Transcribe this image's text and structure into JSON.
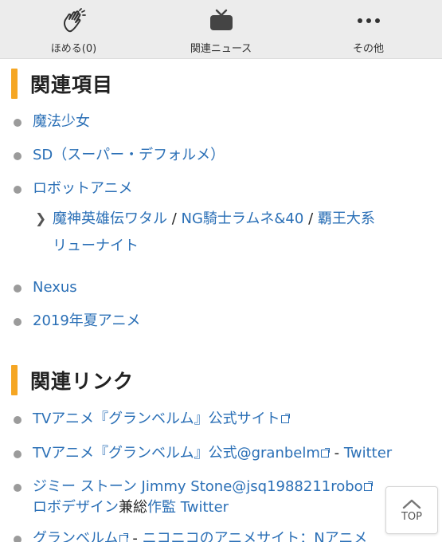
{
  "toolbar": {
    "items": [
      {
        "label": "ほめる(0)",
        "icon": "clap-hands-icon"
      },
      {
        "label": "関連ニュース",
        "icon": "tv-icon"
      },
      {
        "label": "その他",
        "icon": "more-dots-icon"
      }
    ]
  },
  "related_items": {
    "title": "関連項目",
    "items": [
      {
        "text": "魔法少女"
      },
      {
        "text_link": "SD",
        "text_rest": "（スーパー・デフォルメ）"
      },
      {
        "text": "ロボットアニメ"
      },
      {
        "text": "Nexus"
      },
      {
        "text": "2019年夏アニメ"
      }
    ],
    "sub": {
      "link1": "魔神英雄伝ワタル",
      "sep1": " / ",
      "link2": "NG騎士ラムネ&40",
      "sep2": " / ",
      "link3_line1": "覇王大系",
      "link3_line2": "リューナイト"
    }
  },
  "related_links": {
    "title": "関連リンク",
    "items": [
      {
        "link": "TVアニメ『グランベルム』公式サイト"
      },
      {
        "link": "TVアニメ『グランベルム』公式@granbelm",
        "sep": " - ",
        "link2": "Twitter"
      },
      {
        "link_a": "ジミー ストーン Jimmy Stone@jsq1988211robo",
        "rest_link": "ロボデザイン",
        "plain": "兼総",
        "rest_link2": "作監",
        "link_b": " Twitter"
      },
      {
        "link": "グランベルム",
        "sep": " - ",
        "rest": "ニコニコのアニメサイト：Nアニメ"
      }
    ]
  },
  "top_button": {
    "label": "TOP"
  }
}
